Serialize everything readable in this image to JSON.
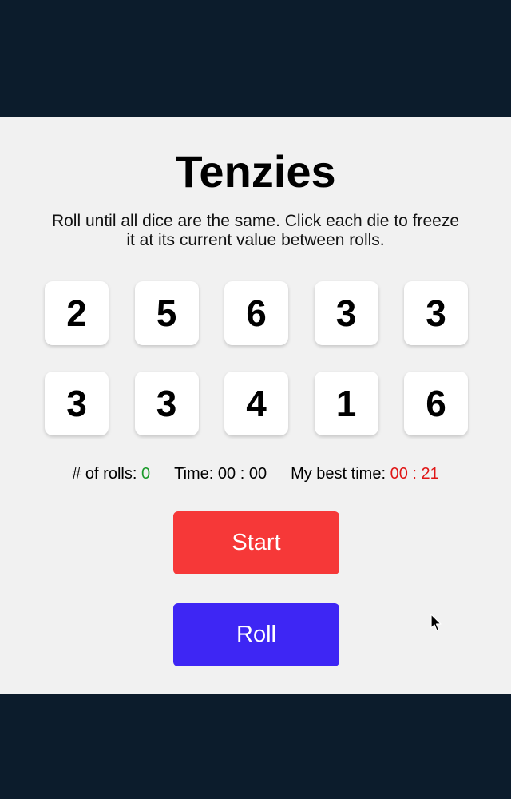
{
  "game": {
    "title": "Tenzies",
    "instructions": "Roll until all dice are the same. Click each die to freeze it at its current value between rolls.",
    "dice": [
      2,
      5,
      6,
      3,
      3,
      3,
      3,
      4,
      1,
      6
    ],
    "stats": {
      "rolls_label": "# of rolls:",
      "rolls_value": "0",
      "time_label": "Time:",
      "time_value": "00 : 00",
      "best_label": "My best time:",
      "best_value": "00 : 21"
    },
    "buttons": {
      "start_label": "Start",
      "roll_label": "Roll"
    }
  },
  "colors": {
    "background": "#0c1c2c",
    "board": "#f1f1f1",
    "start_button": "#f63838",
    "roll_button": "#3e26f4",
    "rolls_value": "#1a9a2a",
    "best_value": "#e01616"
  },
  "icons": {
    "cursor": "mouse-pointer-icon"
  }
}
